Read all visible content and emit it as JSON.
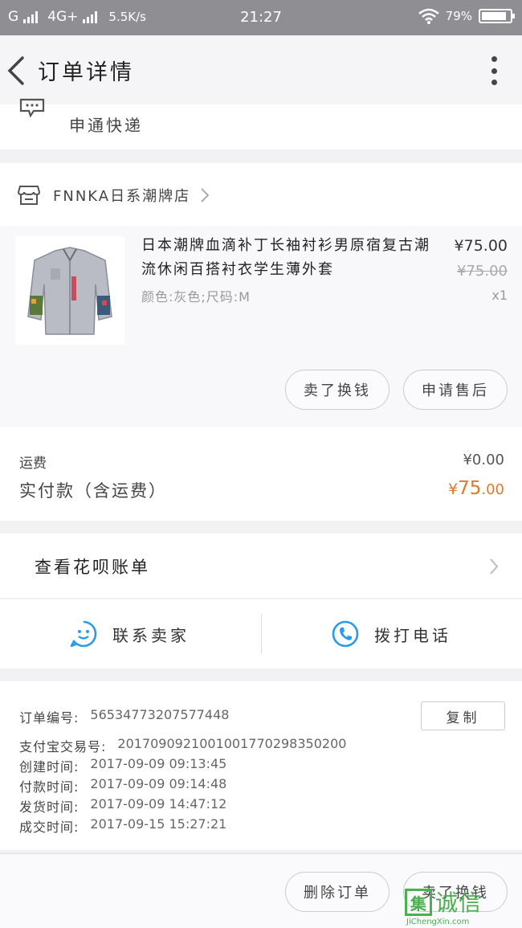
{
  "status_bar": {
    "carrier": "G",
    "network": "4G+",
    "speed": "5.5K/s",
    "time": "21:27",
    "battery_text": "79%",
    "battery_level": 0.79
  },
  "nav": {
    "title": "订单详情"
  },
  "courier": {
    "name": "申通快递"
  },
  "shop": {
    "name": "FNNKA日系潮牌店"
  },
  "product": {
    "title": "日本潮牌血滴补丁长袖衬衫男原宿复古潮流休闲百搭衬衣学生薄外套",
    "spec": "颜色:灰色;尺码:M",
    "price": "¥75.00",
    "original_price": "¥75.00",
    "quantity": "x1",
    "buttons": {
      "sell": "卖了换钱",
      "after_sale": "申请售后"
    }
  },
  "totals": {
    "shipping_label": "运费",
    "shipping_value": "¥0.00",
    "paid_label": "实付款（含运费）",
    "paid_currency": "¥",
    "paid_int": "75",
    "paid_dec": ".00"
  },
  "huabei": {
    "label": "查看花呗账单"
  },
  "contact": {
    "seller": "联系卖家",
    "call": "拨打电话"
  },
  "order_info": {
    "order_no_label": "订单编号:",
    "order_no": "56534773207577448",
    "copy_label": "复制",
    "alipay_label": "支付宝交易号:",
    "alipay_no": "2017090921001001770298350200",
    "created_label": "创建时间:",
    "created": "2017-09-09 09:13:45",
    "paid_label": "付款时间:",
    "paid": "2017-09-09 09:14:48",
    "shipped_label": "发货时间:",
    "shipped": "2017-09-09 14:47:12",
    "done_label": "成交时间:",
    "done": "2017-09-15 15:27:21"
  },
  "bottom": {
    "delete": "删除订单",
    "sell": "卖了换钱"
  },
  "watermark": {
    "box": "集",
    "big": "诚信",
    "url": "JiChengXin.com"
  },
  "colors": {
    "accent_price": "#e07a2a",
    "icon_blue": "#2a9be8",
    "status_bar": "#8f8f93",
    "watermark": "#4caf50"
  }
}
